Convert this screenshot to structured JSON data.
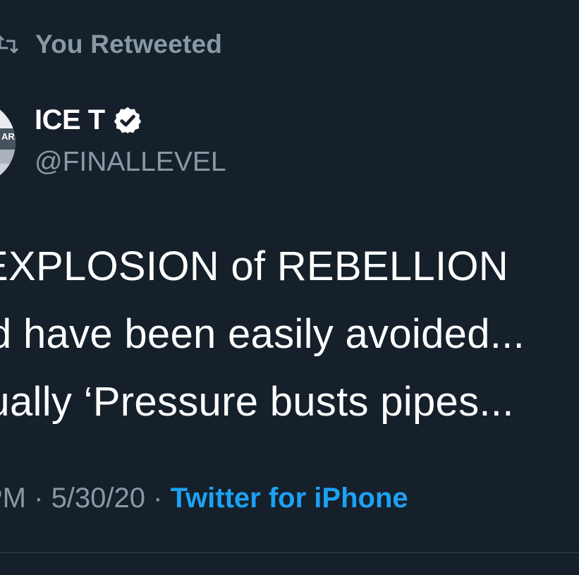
{
  "retweet_header": {
    "icon": "retweet-icon",
    "label": "You Retweeted"
  },
  "author": {
    "display_name": "ICE T",
    "verified_icon": "verified-badge-icon",
    "handle": "@FINALLEVEL",
    "avatar_partial_text": "ARI"
  },
  "tweet": {
    "lines": [
      "EXPLOSION of REBELLION",
      "d have been easily avoided...",
      "tually ‘Pressure busts pipes..."
    ]
  },
  "meta": {
    "time": "PM",
    "sep1": "·",
    "date": "5/30/20",
    "sep2": "·",
    "source": "Twitter for iPhone"
  },
  "colors": {
    "background": "#15202b",
    "secondary_text": "#8899a6",
    "primary_text": "#ffffff",
    "link": "#1da1f2",
    "divider": "#38444d"
  }
}
